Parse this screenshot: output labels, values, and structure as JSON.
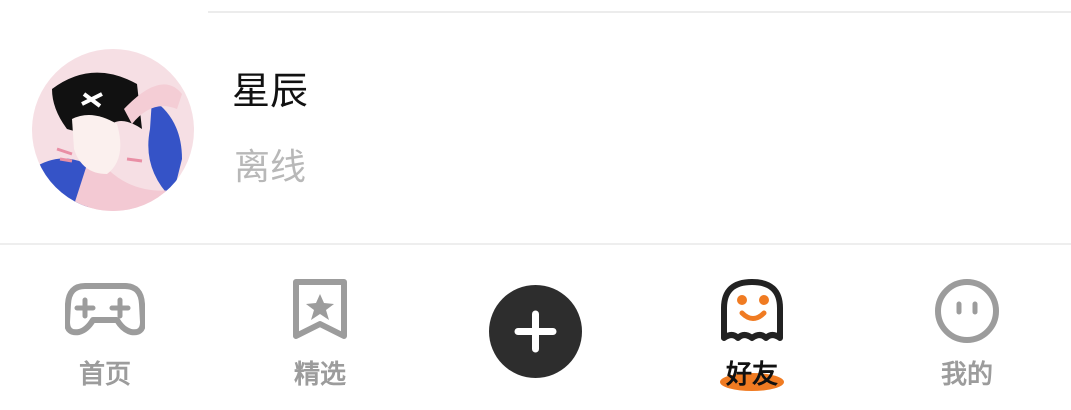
{
  "friend": {
    "name": "星辰",
    "status": "离线"
  },
  "tabs": {
    "home": {
      "label": "首页",
      "icon": "gamepad-icon"
    },
    "featured": {
      "label": "精选",
      "icon": "bookmark-star-icon"
    },
    "add": {
      "icon": "plus-icon"
    },
    "friends": {
      "label": "好友",
      "icon": "ghost-icon",
      "active": true
    },
    "me": {
      "label": "我的",
      "icon": "face-icon"
    }
  },
  "colors": {
    "accent": "#f07b22",
    "inactive": "#9c9c9c",
    "status": "#b8b8b8",
    "add_button": "#2d2d2d"
  }
}
